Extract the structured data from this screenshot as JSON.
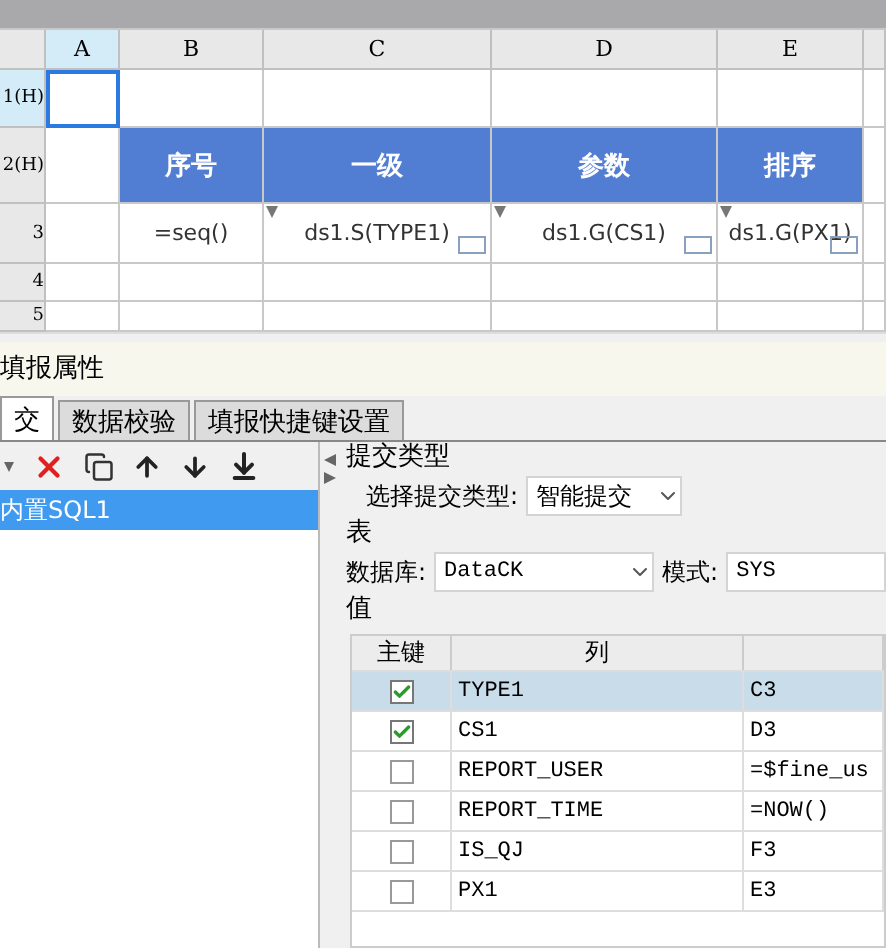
{
  "sheet": {
    "columns": [
      {
        "label": "A",
        "selected": true
      },
      {
        "label": "B",
        "selected": false
      },
      {
        "label": "C",
        "selected": false
      },
      {
        "label": "D",
        "selected": false
      },
      {
        "label": "E",
        "selected": false
      }
    ],
    "rows": [
      {
        "label": "1(H)",
        "kind": "plain",
        "selected": true
      },
      {
        "label": "2(H)",
        "kind": "header",
        "selected": false,
        "cells": [
          "序号",
          "一级",
          "参数",
          "排序"
        ]
      },
      {
        "label": "3",
        "kind": "formula",
        "selected": false,
        "cells": [
          {
            "text": "=seq()",
            "expands": false
          },
          {
            "text": "ds1.S(TYPE1)",
            "expands": true
          },
          {
            "text": "ds1.G(CS1)",
            "expands": true
          },
          {
            "text": "ds1.G(PX1)",
            "expands": true
          }
        ]
      },
      {
        "label": "4",
        "kind": "plain",
        "selected": false
      },
      {
        "label": "5",
        "kind": "plain",
        "selected": false
      }
    ]
  },
  "panel": {
    "title": "填报属性",
    "tabs": [
      {
        "label": "交",
        "selected": true
      },
      {
        "label": "数据校验",
        "selected": false
      },
      {
        "label": "填报快捷键设置",
        "selected": false
      }
    ],
    "submissions": [
      {
        "label": "内置SQL1",
        "selected": true
      }
    ],
    "submit_type": {
      "legend": "提交类型",
      "label": "选择提交类型:",
      "value": "智能提交"
    },
    "table": {
      "legend": "表",
      "database_label": "数据库:",
      "database": "DataCK",
      "schema_label": "模式:",
      "schema": "SYS"
    },
    "values": {
      "legend": "值",
      "columns": [
        "主键",
        "列"
      ],
      "rows": [
        {
          "key": true,
          "column": "TYPE1",
          "value": "C3",
          "selected": true
        },
        {
          "key": true,
          "column": "CS1",
          "value": "D3",
          "selected": false
        },
        {
          "key": false,
          "column": "REPORT_USER",
          "value": "=$fine_us",
          "selected": false
        },
        {
          "key": false,
          "column": "REPORT_TIME",
          "value": "=NOW()",
          "selected": false
        },
        {
          "key": false,
          "column": "IS_QJ",
          "value": "F3",
          "selected": false
        },
        {
          "key": false,
          "column": "PX1",
          "value": "E3",
          "selected": false
        }
      ]
    }
  }
}
